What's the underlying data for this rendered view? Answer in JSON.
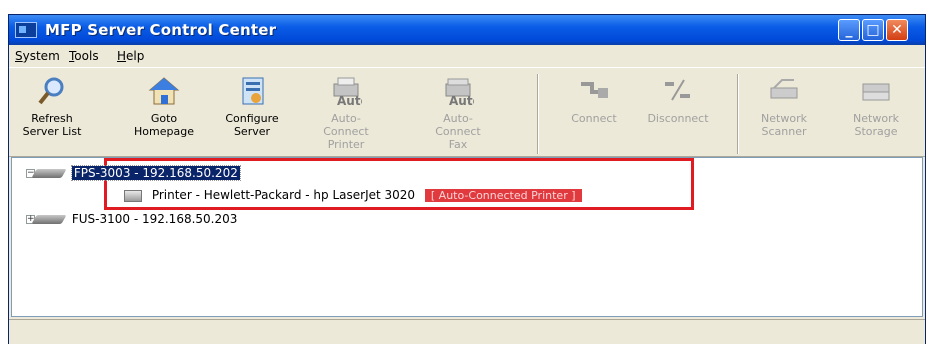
{
  "window": {
    "title": "MFP Server Control Center"
  },
  "menu": [
    {
      "accel": "S",
      "rest": "ystem"
    },
    {
      "accel": "T",
      "rest": "ools"
    },
    {
      "accel": "H",
      "rest": "elp"
    }
  ],
  "toolbar": {
    "refresh": {
      "line1": "Refresh",
      "line2": "Server List",
      "icon": "magnifier-icon"
    },
    "goto": {
      "line1": "Goto",
      "line2": "Homepage",
      "icon": "house-icon"
    },
    "configure": {
      "line1": "Configure",
      "line2": "Server",
      "icon": "config-icon"
    },
    "auto_printer": {
      "overlay": "Auto",
      "line1": "Auto-Connect",
      "line2": "Printer",
      "icon": "printer-icon"
    },
    "auto_fax": {
      "overlay": "Auto",
      "line1": "Auto-Connect",
      "line2": "Fax",
      "icon": "fax-icon"
    },
    "connect": {
      "line1": "Connect",
      "icon": "plug-connect-icon"
    },
    "disconnect": {
      "line1": "Disconnect",
      "icon": "plug-disconnect-icon"
    },
    "net_scanner": {
      "line1": "Network",
      "line2": "Scanner",
      "icon": "scanner-icon"
    },
    "net_storage": {
      "line1": "Network",
      "line2": "Storage",
      "icon": "storage-icon"
    }
  },
  "tree": {
    "server1": {
      "label": "FPS-3003 - 192.168.50.202",
      "expander": "−"
    },
    "printer": {
      "label": "Printer - Hewlett-Packard - hp LaserJet 3020",
      "badge": "[ Auto-Connected Printer ]"
    },
    "server2": {
      "label": "FUS-3100 - 192.168.50.203",
      "expander": "+"
    }
  },
  "colors": {
    "highlight": "#e11b22",
    "selection": "#0a246a",
    "badge": "#e0393e"
  }
}
